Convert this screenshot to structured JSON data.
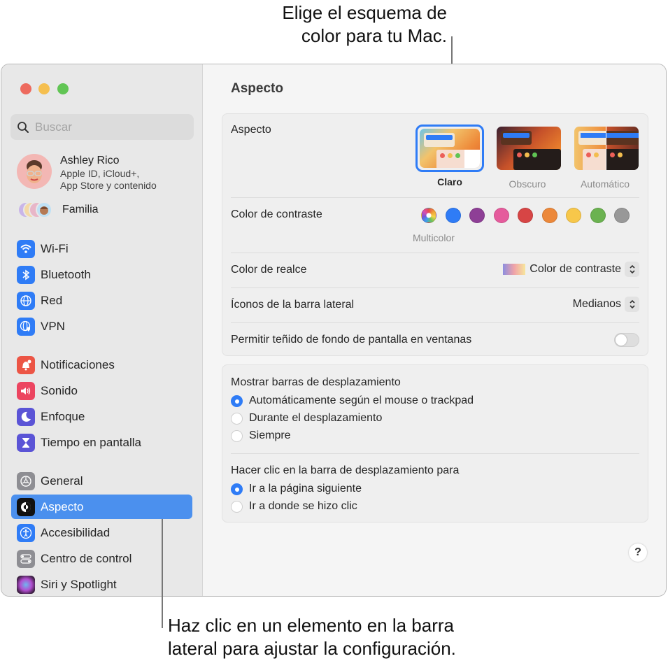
{
  "callouts": {
    "top": [
      "Elige el esquema de",
      "color para tu Mac."
    ],
    "bottom": [
      "Haz clic en un elemento en la barra",
      "lateral para ajustar la configuración."
    ]
  },
  "sidebar": {
    "search_placeholder": "Buscar",
    "account": {
      "name": "Ashley Rico",
      "line1": "Apple ID, iCloud+,",
      "line2": "App Store y contenido"
    },
    "family_label": "Familia",
    "items": [
      {
        "label": "Wi-Fi",
        "icon": "wifi-icon",
        "color": "#2f7cf6"
      },
      {
        "label": "Bluetooth",
        "icon": "bluetooth-icon",
        "color": "#2f7cf6"
      },
      {
        "label": "Red",
        "icon": "globe-icon",
        "color": "#2f7cf6"
      },
      {
        "label": "VPN",
        "icon": "vpn-globe-icon",
        "color": "#2f7cf6"
      },
      {
        "label": "Notificaciones",
        "icon": "bell-icon",
        "color": "#ec5545"
      },
      {
        "label": "Sonido",
        "icon": "speaker-icon",
        "color": "#ec4560"
      },
      {
        "label": "Enfoque",
        "icon": "moon-icon",
        "color": "#5b54d6"
      },
      {
        "label": "Tiempo en pantalla",
        "icon": "hourglass-icon",
        "color": "#5b54d6"
      },
      {
        "label": "General",
        "icon": "gear-icon",
        "color": "#8e8e93"
      },
      {
        "label": "Aspecto",
        "icon": "appearance-icon",
        "color": "#111111",
        "selected": true
      },
      {
        "label": "Accesibilidad",
        "icon": "accessibility-icon",
        "color": "#2f7cf6"
      },
      {
        "label": "Centro de control",
        "icon": "control-center-icon",
        "color": "#8e8e93"
      },
      {
        "label": "Siri y Spotlight",
        "icon": "siri-icon",
        "color": "#8d2a8a"
      }
    ]
  },
  "main": {
    "title": "Aspecto",
    "appearance": {
      "label": "Aspecto",
      "options": [
        {
          "label": "Claro",
          "selected": true
        },
        {
          "label": "Obscuro",
          "selected": false
        },
        {
          "label": "Automático",
          "selected": false
        }
      ]
    },
    "accent": {
      "label": "Color de contraste",
      "selected_label": "Multicolor",
      "colors": [
        {
          "name": "Multicolor",
          "hex": "multicolor"
        },
        {
          "name": "Azul",
          "hex": "#2f7cf6"
        },
        {
          "name": "Morado",
          "hex": "#8e3f96"
        },
        {
          "name": "Rosa",
          "hex": "#e55b9c"
        },
        {
          "name": "Rojo",
          "hex": "#d74545"
        },
        {
          "name": "Naranja",
          "hex": "#ec883a"
        },
        {
          "name": "Amarillo",
          "hex": "#f7c74a"
        },
        {
          "name": "Verde",
          "hex": "#6bb250"
        },
        {
          "name": "Grafito",
          "hex": "#989898"
        }
      ]
    },
    "highlight": {
      "label": "Color de realce",
      "value": "Color de contraste"
    },
    "sidebar_icons": {
      "label": "Íconos de la barra lateral",
      "value": "Medianos"
    },
    "wallpaper_tint": {
      "label": "Permitir teñido de fondo de pantalla en ventanas",
      "enabled": false
    },
    "scrollbars": {
      "label": "Mostrar barras de desplazamiento",
      "options": [
        {
          "label": "Automáticamente según el mouse o trackpad",
          "checked": true
        },
        {
          "label": "Durante el desplazamiento",
          "checked": false
        },
        {
          "label": "Siempre",
          "checked": false
        }
      ]
    },
    "click_scroll": {
      "label": "Hacer clic en la barra de desplazamiento para",
      "options": [
        {
          "label": "Ir a la página siguiente",
          "checked": true
        },
        {
          "label": "Ir a donde se hizo clic",
          "checked": false
        }
      ]
    },
    "help_label": "?"
  }
}
